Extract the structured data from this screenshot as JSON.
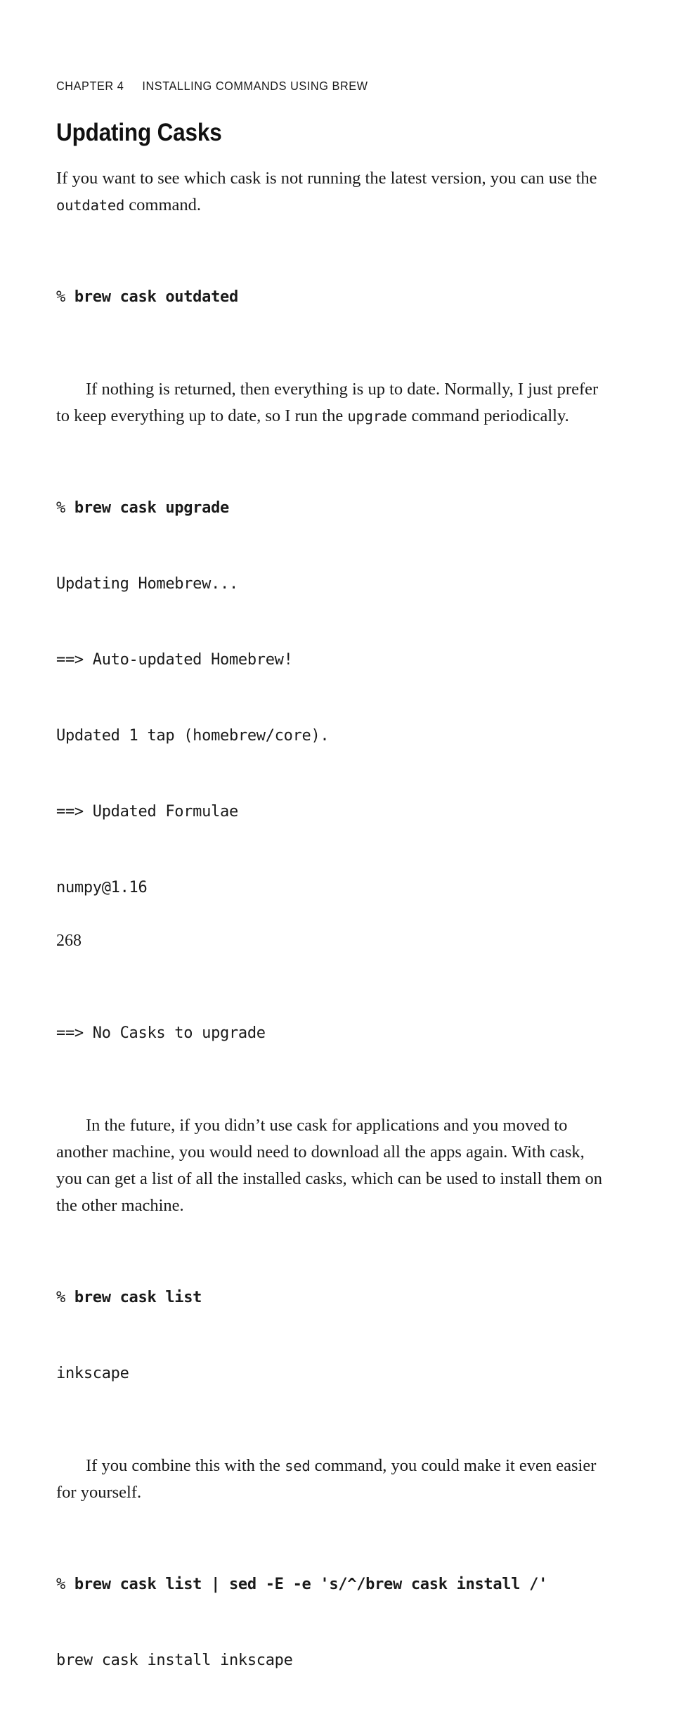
{
  "running_head": {
    "chapter_label": "CHAPTER 4",
    "chapter_title": "INSTALLING COMMANDS USING BREW"
  },
  "section": {
    "title": "Updating Casks"
  },
  "paragraphs": {
    "p1": "If you want to see which cask is not running the latest version, you can use the ",
    "p1_code": "outdated",
    "p1_tail": " command.",
    "p2_a": "If nothing is returned, then everything is up to date. Normally, I just prefer to keep everything up to date, so I run the ",
    "p2_code": "upgrade",
    "p2_tail": " command periodically.",
    "p3": "In the future, if you didn’t use cask for applications and you moved to another machine, you would need to download all the apps again. With cask, you can get a list of all the installed casks, which can be used to install them on the other machine.",
    "p4_a": "If you combine this with the ",
    "p4_code": "sed",
    "p4_tail": " command, you could make it even easier for yourself."
  },
  "code_blocks": {
    "block1": {
      "lines": [
        {
          "prompt": "% ",
          "command": "brew cask outdated",
          "bold": true
        }
      ]
    },
    "block2": {
      "lines": [
        {
          "prompt": "% ",
          "command": "brew cask upgrade",
          "bold": true
        },
        {
          "prompt": "",
          "command": "Updating Homebrew...",
          "bold": false
        },
        {
          "prompt": "",
          "command": "==> Auto-updated Homebrew!",
          "bold": false
        },
        {
          "prompt": "",
          "command": "Updated 1 tap (homebrew/core).",
          "bold": false
        },
        {
          "prompt": "",
          "command": "==> Updated Formulae",
          "bold": false
        },
        {
          "prompt": "",
          "command": "numpy@1.16",
          "bold": false
        },
        {
          "prompt": "",
          "command": "",
          "bold": false
        },
        {
          "prompt": "",
          "command": "==> No Casks to upgrade",
          "bold": false
        }
      ]
    },
    "block3": {
      "lines": [
        {
          "prompt": "% ",
          "command": "brew cask list",
          "bold": true
        },
        {
          "prompt": "",
          "command": "inkscape",
          "bold": false
        }
      ]
    },
    "block4": {
      "lines": [
        {
          "prompt": "% ",
          "command": "brew cask list | sed -E -e 's/^/brew cask install /'",
          "bold": true
        },
        {
          "prompt": "",
          "command": "brew cask install inkscape",
          "bold": false
        }
      ]
    }
  },
  "folio": {
    "page_number": "268"
  }
}
